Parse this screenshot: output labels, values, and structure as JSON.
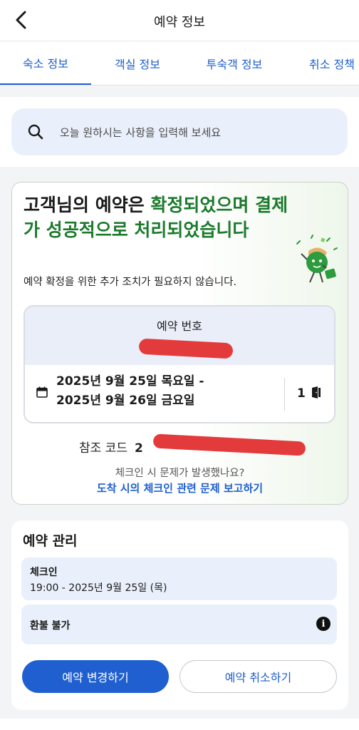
{
  "header": {
    "title": "예약 정보"
  },
  "tabs": [
    {
      "label": "숙소 정보",
      "active": true
    },
    {
      "label": "객실 정보",
      "active": false
    },
    {
      "label": "투숙객 정보",
      "active": false
    },
    {
      "label": "취소 정책",
      "active": false
    }
  ],
  "search": {
    "placeholder": "오늘 원하시는 사항을 입력해 보세요"
  },
  "confirmation": {
    "title_part1": "고객님의 예약은 ",
    "title_part2": "확정되었으며 결제가 성공적으로 처리되었습니다",
    "subtitle": "예약 확정을 위한 추가 조치가 필요하지 않습니다.",
    "booking_number_label": "예약 번호",
    "date_line1": "2025년 9월 25일 목요일 -",
    "date_line2": "2025년 9월 26일 금요일",
    "room_count": "1",
    "reference_label": "참조 코드",
    "reference_code_visible": "2",
    "checkin_question": "체크인 시 문제가 발생했나요?",
    "report_link": "도착 시의 체크인 관련 문제 보고하기"
  },
  "manage": {
    "title": "예약 관리",
    "checkin_label": "체크인",
    "checkin_time": "19:00 - 2025년 9월 25일 (목)",
    "refund_label": "환불 불가",
    "change_button": "예약 변경하기",
    "cancel_button": "예약 취소하기"
  },
  "colors": {
    "accent_blue": "#1f5fcf",
    "success_green": "#1b7a2c",
    "light_blue_bg": "#eaf0fb",
    "redaction_red": "#e33b3b"
  }
}
